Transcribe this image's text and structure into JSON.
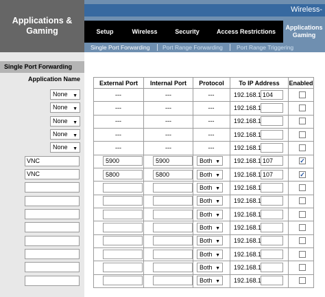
{
  "header": {
    "section_title": "Applications & Gaming",
    "brand_text": "Wireless-"
  },
  "main_tabs": [
    {
      "label": "Setup",
      "active": false
    },
    {
      "label": "Wireless",
      "active": false
    },
    {
      "label": "Security",
      "active": false
    },
    {
      "label": "Access Restrictions",
      "active": false
    },
    {
      "label": "Applications Gaming",
      "active": true
    }
  ],
  "sub_tabs": [
    {
      "label": "Single Port Forwarding",
      "active": true
    },
    {
      "label": "Port Range Forwarding",
      "active": false
    },
    {
      "label": "Port Range Triggering",
      "active": false
    }
  ],
  "left_panel": {
    "section_label": "Single Port Forwarding",
    "application_name_label": "Application Name"
  },
  "table": {
    "headers": {
      "external_port": "External Port",
      "internal_port": "Internal Port",
      "protocol": "Protocol",
      "to_ip": "To IP Address",
      "enabled": "Enabled"
    },
    "ip_prefix": "192.168.1.",
    "rows": [
      {
        "kind": "select",
        "app": "None",
        "ext": "---",
        "int": "---",
        "proto": "---",
        "ip": "104",
        "enabled": false
      },
      {
        "kind": "select",
        "app": "None",
        "ext": "---",
        "int": "---",
        "proto": "---",
        "ip": "",
        "enabled": false
      },
      {
        "kind": "select",
        "app": "None",
        "ext": "---",
        "int": "---",
        "proto": "---",
        "ip": "",
        "enabled": false
      },
      {
        "kind": "select",
        "app": "None",
        "ext": "---",
        "int": "---",
        "proto": "---",
        "ip": "",
        "enabled": false
      },
      {
        "kind": "select",
        "app": "None",
        "ext": "---",
        "int": "---",
        "proto": "---",
        "ip": "",
        "enabled": false
      },
      {
        "kind": "input",
        "app": "VNC",
        "ext": "5900",
        "int": "5900",
        "proto": "Both",
        "ip": "107",
        "enabled": true
      },
      {
        "kind": "input",
        "app": "VNC",
        "ext": "5800",
        "int": "5800",
        "proto": "Both",
        "ip": "107",
        "enabled": true
      },
      {
        "kind": "input",
        "app": "",
        "ext": "",
        "int": "",
        "proto": "Both",
        "ip": "",
        "enabled": false
      },
      {
        "kind": "input",
        "app": "",
        "ext": "",
        "int": "",
        "proto": "Both",
        "ip": "",
        "enabled": false
      },
      {
        "kind": "input",
        "app": "",
        "ext": "",
        "int": "",
        "proto": "Both",
        "ip": "",
        "enabled": false
      },
      {
        "kind": "input",
        "app": "",
        "ext": "",
        "int": "",
        "proto": "Both",
        "ip": "",
        "enabled": false
      },
      {
        "kind": "input",
        "app": "",
        "ext": "",
        "int": "",
        "proto": "Both",
        "ip": "",
        "enabled": false
      },
      {
        "kind": "input",
        "app": "",
        "ext": "",
        "int": "",
        "proto": "Both",
        "ip": "",
        "enabled": false
      },
      {
        "kind": "input",
        "app": "",
        "ext": "",
        "int": "",
        "proto": "Both",
        "ip": "",
        "enabled": false
      },
      {
        "kind": "input",
        "app": "",
        "ext": "",
        "int": "",
        "proto": "Both",
        "ip": "",
        "enabled": false
      }
    ]
  },
  "colors": {
    "header_gray": "#666666",
    "tab_blue": "#6f8fb0",
    "brand_blue": "#3769a0",
    "left_panel_bg": "#e8e8e8"
  },
  "icons": {
    "dropdown": "chevron-down-icon",
    "checkbox_checked": "checkmark-icon"
  }
}
